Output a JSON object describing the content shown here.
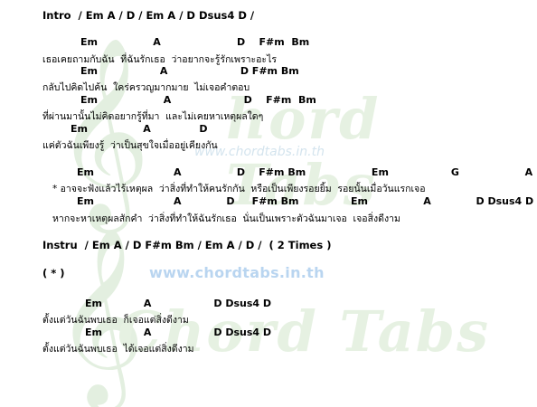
{
  "watermark": {
    "site": "www.chordtabs.in.th",
    "faint_site": "www.chordtabs.in.th",
    "art_text_1": "hord Tabs",
    "art_text_2": "Chord Tabs"
  },
  "song": {
    "intro": "Intro  / Em A / D / Em A / D Dsus4 D /",
    "v1_c1": "Em                A                      D    F#m  Bm",
    "v1_l1": "เธอเคยถามกับฉัน  ที่ฉันรักเธอ  ว่าอยากจะรู้รักเพราะอะไร",
    "v1_c2": "Em                  A                     D F#m Bm",
    "v1_l2": "กลับไปคิดไปค้น  ใคร่ครวญมากมาย  ไม่เจอคำตอบ",
    "v1_c3": "Em                   A                     D    F#m  Bm",
    "v1_l3": "ที่ผ่านมานั้นไม่คิดอยากรู้ที่มา  และไม่เคยหาเหตุผลใดๆ",
    "v1_c4": "Em                A              D",
    "v1_l4": "แค่ตัวฉันเพียงรู้  ว่าเป็นสุขใจเมื่ออยู่เคียงกัน",
    "ch_c1": "Em                       A                D    F#m Bm                   Em                  G                   A",
    "ch_l1": "* อาจจะฟังแล้วไร้เหตุผล  ว่าสิ่งที่ทำให้คนรักกัน  หรือเป็นเพียงรอยยิ้ม  รอยนั้นเมื่อวันแรกเจอ",
    "ch_c2": "Em                       A             D     F#m Bm               Em                A             D Dsus4 D",
    "ch_l2": "หากจะหาเหตุผลสักคำ  ว่าสิ่งที่ทำให้ฉันรักเธอ  นั่นเป็นเพราะตัวฉันมาเจอ  เจอสิ่งดีงาม",
    "instru": "Instru  / Em A / D F#m Bm / Em A / D /  ( 2 Times )",
    "star": "( * )",
    "end_c1": "Em            A                  D Dsus4 D",
    "end_l1": "ตั้งแต่วันฉันพบเธอ  ก็เจอแต่สิ่งดีงาม",
    "end_c2": "Em            A                  D Dsus4 D",
    "end_l2": "ตั้งแต่วันฉันพบเธอ  ได้เจอแต่สิ่งดีงาม"
  }
}
